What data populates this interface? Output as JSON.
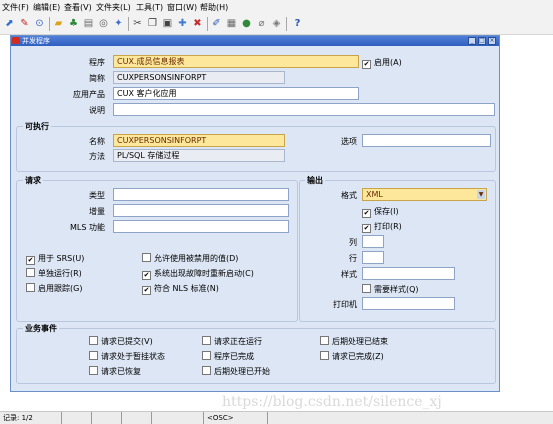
{
  "menu": [
    "文件(F)",
    "编辑(E)",
    "查看(V)",
    "文件夹(L)",
    "工具(T)",
    "窗口(W)",
    "帮助(H)"
  ],
  "window": {
    "title": "并发程序"
  },
  "program": {
    "program_label": "程序",
    "program_value": "CUX.成员信息报表",
    "enabled_label": "启用(A)",
    "enabled_checked": true,
    "short_name_label": "简称",
    "short_name_value": "CUXPERSONSINFORPT",
    "application_label": "应用产品",
    "application_value": "CUX 客户化应用",
    "description_label": "说明",
    "description_value": ""
  },
  "executable": {
    "title": "可执行",
    "name_label": "名称",
    "name_value": "CUXPERSONSINFORPT",
    "options_label": "选项",
    "options_value": "",
    "method_label": "方法",
    "method_value": "PL/SQL 存储过程"
  },
  "request": {
    "title": "请求",
    "type_label": "类型",
    "increment_label": "增量",
    "mls_label": "MLS 功能",
    "checkboxes": [
      {
        "label": "用于 SRS(U)",
        "checked": true
      },
      {
        "label": "允许使用被禁用的值(D)",
        "checked": false
      },
      {
        "label": "单独运行(R)",
        "checked": false
      },
      {
        "label": "系统出现故障时重新启动(C)",
        "checked": true
      },
      {
        "label": "启用跟踪(G)",
        "checked": false
      },
      {
        "label": "符合 NLS 标准(N)",
        "checked": true
      }
    ]
  },
  "output": {
    "title": "输出",
    "format_label": "格式",
    "format_value": "XML",
    "save_label": "保存(I)",
    "save_checked": true,
    "print_label": "打印(R)",
    "print_checked": true,
    "columns_label": "列",
    "rows_label": "行",
    "style_label": "样式",
    "required_style_label": "需要样式(Q)",
    "required_style_checked": false,
    "printer_label": "打印机"
  },
  "business_events": {
    "title": "业务事件",
    "items": [
      "请求已提交(V)",
      "请求正在运行",
      "后期处理已结束",
      "请求处于暂挂状态",
      "程序已完成",
      "请求已完成(Z)",
      "请求已恢复",
      "后期处理已开始"
    ]
  },
  "status": {
    "record": "记录: 1/2",
    "osc": "<OSC>"
  },
  "watermark": "https://blog.csdn.net/silence_xj"
}
